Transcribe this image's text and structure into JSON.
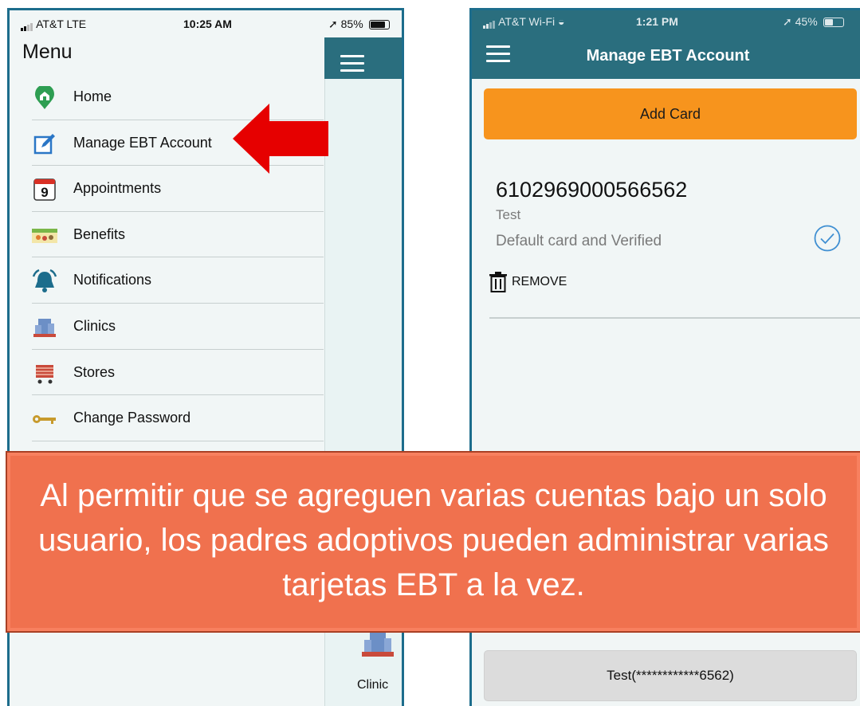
{
  "left_phone": {
    "status": {
      "carrier": "AT&T  LTE",
      "time": "10:25 AM",
      "battery": "85%"
    },
    "menu_title": "Menu",
    "menu_items": [
      {
        "label": "Home",
        "icon": "home-icon"
      },
      {
        "label": "Manage EBT Account",
        "icon": "edit-icon"
      },
      {
        "label": "Appointments",
        "icon": "calendar-icon"
      },
      {
        "label": "Benefits",
        "icon": "benefits-icon"
      },
      {
        "label": "Notifications",
        "icon": "bell-icon"
      },
      {
        "label": "Clinics",
        "icon": "clinic-icon"
      },
      {
        "label": "Stores",
        "icon": "cart-icon"
      },
      {
        "label": "Change Password",
        "icon": "key-icon"
      }
    ],
    "calendar_day": "9",
    "clinic_label": "Clinic"
  },
  "right_phone": {
    "status": {
      "carrier": "AT&T Wi-Fi",
      "time": "1:21 PM",
      "battery": "45%"
    },
    "nav_title": "Manage EBT Account",
    "add_card_label": "Add Card",
    "card": {
      "number": "6102969000566562",
      "name": "Test",
      "status": "Default card and Verified",
      "remove_label": "REMOVE"
    },
    "selected_card_label": "Test(************6562)"
  },
  "banner": {
    "text": "Al permitir que se agreguen varias cuentas bajo un solo usuario, los padres adoptivos pueden administrar varias tarjetas EBT a la vez."
  },
  "colors": {
    "header_teal": "#2a6e7e",
    "phone_border": "#1d6d8c",
    "add_card_orange": "#f7941d",
    "banner_orange": "#f0714e",
    "arrow_red": "#e60000",
    "check_blue": "#3f8fd2"
  }
}
